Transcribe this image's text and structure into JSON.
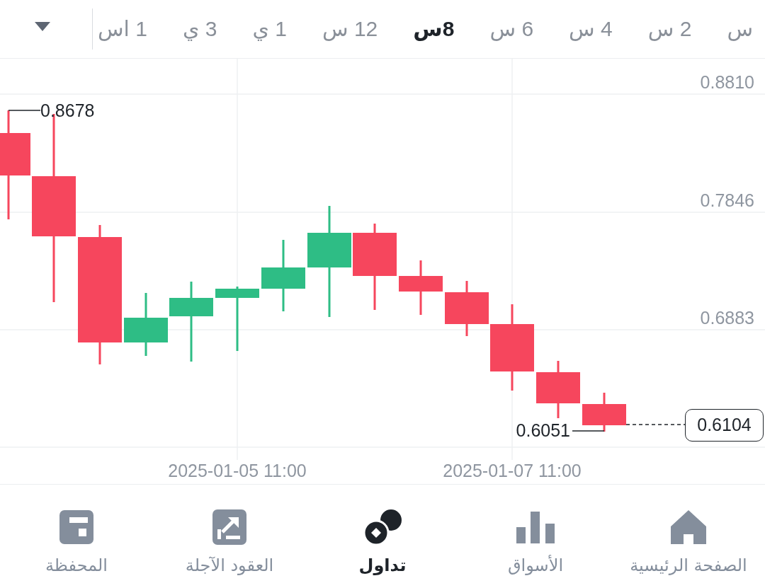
{
  "timeframes": [
    {
      "label": "س",
      "selected": false
    },
    {
      "label": "2 س",
      "selected": false
    },
    {
      "label": "4 س",
      "selected": false
    },
    {
      "label": "6 س",
      "selected": false
    },
    {
      "label": "8س",
      "selected": true
    },
    {
      "label": "12 س",
      "selected": false
    },
    {
      "label": "1 ي",
      "selected": false
    },
    {
      "label": "3 ي",
      "selected": false
    },
    {
      "label": "1 اس",
      "selected": false
    }
  ],
  "chart": {
    "price_labels": [
      "0.8810",
      "0.7846",
      "0.6883"
    ],
    "time_labels": [
      "2025-01-07 11:00",
      "2025-01-05 11:00"
    ],
    "high_label": "0.8678",
    "low_label": "0.6051",
    "last_price": "0.6104",
    "candles": [
      {
        "kind": "falling"
      },
      {
        "kind": "falling"
      },
      {
        "kind": "falling"
      },
      {
        "kind": "rising"
      },
      {
        "kind": "rising"
      },
      {
        "kind": "rising"
      },
      {
        "kind": "rising"
      },
      {
        "kind": "rising"
      },
      {
        "kind": "falling"
      },
      {
        "kind": "falling"
      },
      {
        "kind": "falling"
      },
      {
        "kind": "falling"
      },
      {
        "kind": "falling"
      },
      {
        "kind": "falling"
      }
    ]
  },
  "bottom_nav": [
    {
      "label": "الصفحة الرئيسية",
      "selected": false
    },
    {
      "label": "الأسواق",
      "selected": false
    },
    {
      "label": "تداول",
      "selected": true
    },
    {
      "label": "العقود الآجلة",
      "selected": false
    },
    {
      "label": "المحفظة",
      "selected": false
    }
  ]
}
